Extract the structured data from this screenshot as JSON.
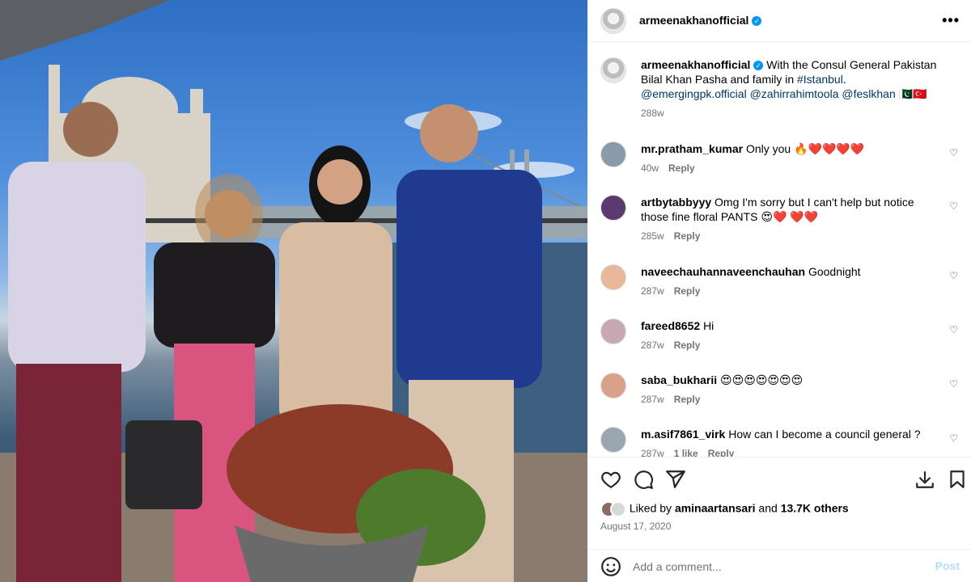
{
  "post": {
    "author": "armeenakhanofficial",
    "verified_glyph": "✓",
    "more_glyph": "•••"
  },
  "caption": {
    "author": "armeenakhanofficial",
    "text_pre": "With the Consul General Pakistan Bilal Khan Pasha and family in ",
    "hashtag": "#Istanbul",
    "text_post": ".",
    "mentions": "@emergingpk.official @zahirrahimtoola @feslkhan",
    "flags": "🇵🇰🇹🇷",
    "time": "288w"
  },
  "comments": [
    {
      "user": "mr.pratham_kumar",
      "text": "Only you 🔥❤️❤️❤️❤️",
      "time": "40w",
      "reply": "Reply",
      "avatar_color": "#8a9aa8"
    },
    {
      "user": "artbytabbyyy",
      "text": "Omg I'm sorry but I can't help but notice those fine floral PANTS 😍❤️ ❤️❤️",
      "time": "285w",
      "reply": "Reply",
      "avatar_color": "#5b3a6e"
    },
    {
      "user": "naveechauhannaveenchauhan",
      "text": "Goodnight",
      "time": "287w",
      "reply": "Reply",
      "avatar_color": "#e9b79a"
    },
    {
      "user": "fareed8652",
      "text": "Hi",
      "time": "287w",
      "reply": "Reply",
      "avatar_color": "#c8a9b3"
    },
    {
      "user": "saba_bukharii",
      "text": "😍😍😍😍😍😍😍",
      "time": "287w",
      "reply": "Reply",
      "avatar_color": "#d9a08a"
    },
    {
      "user": "m.asif7861_virk",
      "text": "How can I become a council general ?",
      "time": "287w",
      "likes": "1 like",
      "reply": "Reply",
      "avatar_color": "#9aa7b0"
    }
  ],
  "actions": {
    "like_icon": "heart-icon",
    "comment_icon": "comment-icon",
    "share_icon": "share-icon",
    "download_icon": "download-icon",
    "save_icon": "bookmark-icon"
  },
  "likes": {
    "prefix": "Liked by ",
    "user": "aminaartansari",
    "middle": " and ",
    "count": "13.7K others"
  },
  "date": "August 17, 2020",
  "comment_input": {
    "placeholder": "Add a comment...",
    "post_label": "Post"
  },
  "colors": {
    "verified": "#0095f6",
    "post_disabled": "#b2dffc",
    "link": "#00376b"
  }
}
